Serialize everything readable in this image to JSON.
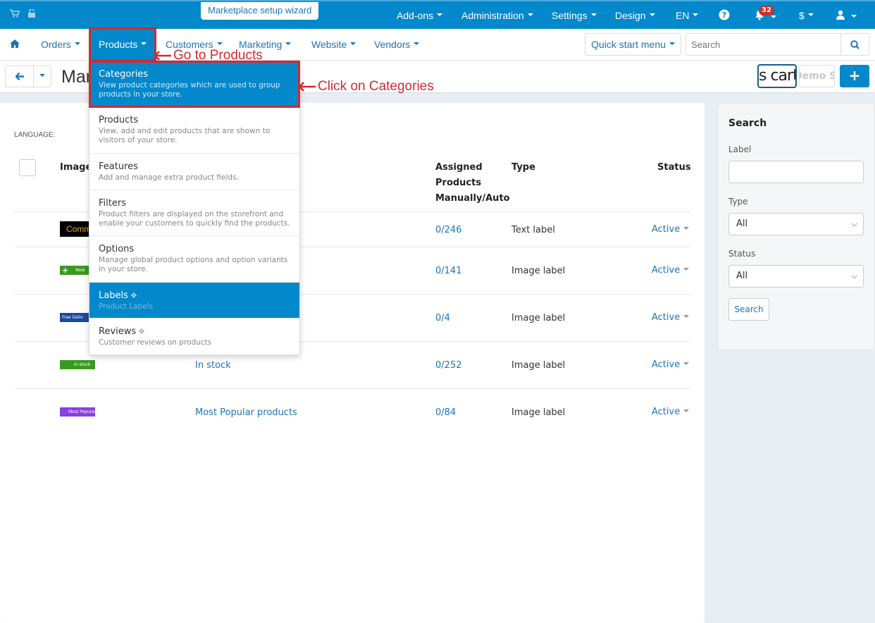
{
  "topbar": {
    "wizard_label": "Marketplace setup wizard",
    "menu": [
      {
        "label": "Add-ons"
      },
      {
        "label": "Administration"
      },
      {
        "label": "Settings"
      },
      {
        "label": "Design"
      },
      {
        "label": "EN"
      }
    ],
    "notifications_count": "32",
    "currency": "$"
  },
  "mainnav": {
    "items": [
      {
        "label": "Orders"
      },
      {
        "label": "Products"
      },
      {
        "label": "Customers"
      },
      {
        "label": "Marketing"
      },
      {
        "label": "Website"
      },
      {
        "label": "Vendors"
      }
    ],
    "quick_start_label": "Quick start menu",
    "search_placeholder": "Search"
  },
  "pagehead": {
    "title": "Manage labels",
    "store_button_text": "s cart",
    "demo_button_text": "Demo Store",
    "add_label": "+"
  },
  "dropdown": {
    "items": [
      {
        "title": "Categories",
        "desc": "View product categories which are used to group products in your store."
      },
      {
        "title": "Products",
        "desc": "View, add and edit products that are shown to visitors of your store."
      },
      {
        "title": "Features",
        "desc": "Add and manage extra product fields."
      },
      {
        "title": "Filters",
        "desc": "Product filters are displayed on the storefront and enable your customers to quickly find the products."
      },
      {
        "title": "Options",
        "desc": "Manage global product options and option variants in your store."
      },
      {
        "title": "Labels",
        "desc": "Product Labels"
      },
      {
        "title": "Reviews",
        "desc": "Customer reviews on products"
      }
    ]
  },
  "annotations": {
    "go_to_products": "Go to Products",
    "click_categories": "Click on Categories"
  },
  "table": {
    "language_label": "LANGUAGE:",
    "headers": {
      "image": "Image",
      "assigned_line1": "Assigned",
      "assigned_line2": "Products",
      "assigned_line3": "Manually/Auto",
      "type": "Type",
      "status": "Status"
    },
    "rows": [
      {
        "image_text": "Comm",
        "image_color": "#000000",
        "name": "",
        "assigned": "0/246",
        "type": "Text label",
        "status": "Active"
      },
      {
        "image_text": "+  New",
        "image_color": "#3a9a1e",
        "name": "",
        "assigned": "0/141",
        "type": "Image label",
        "status": "Active"
      },
      {
        "image_text": "Free Deliv",
        "image_color": "#1b4a9c",
        "name": "",
        "assigned": "0/4",
        "type": "Image label",
        "status": "Active"
      },
      {
        "image_text": "In stock",
        "image_color": "#3a9a1e",
        "name": "In stock",
        "assigned": "0/252",
        "type": "Image label",
        "status": "Active"
      },
      {
        "image_text": "Most Popular",
        "image_color": "#8a3fe0",
        "name": "Most Popular products",
        "assigned": "0/84",
        "type": "Image label",
        "status": "Active"
      }
    ]
  },
  "sidebar": {
    "title": "Search",
    "label_field": {
      "label": "Label",
      "value": ""
    },
    "type_field": {
      "label": "Type",
      "value": "All"
    },
    "status_field": {
      "label": "Status",
      "value": "All"
    },
    "search_button": "Search"
  },
  "colors": {
    "brand": "#0388cc",
    "annotation": "#d02b32",
    "link": "#1a76b8"
  }
}
